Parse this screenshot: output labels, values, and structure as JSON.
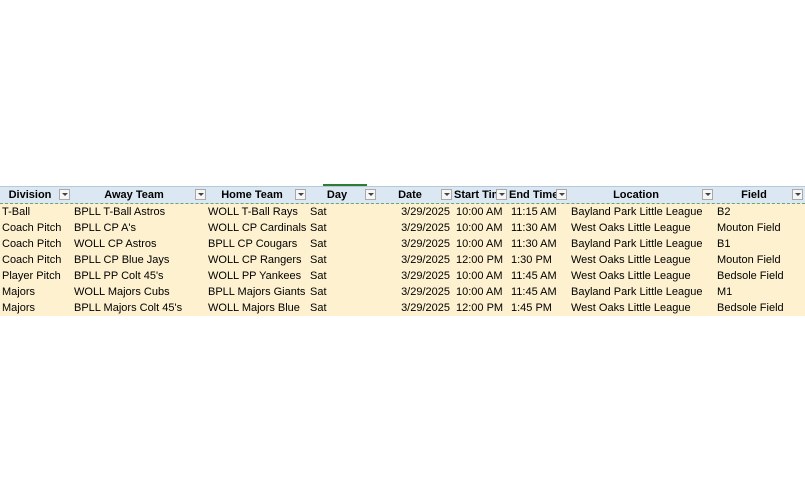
{
  "table": {
    "headers": [
      "Division",
      "Away Team",
      "Home Team",
      "Day",
      "Date",
      "Start Tim",
      "End Time",
      "Location",
      "Field"
    ],
    "rows": [
      [
        "T-Ball",
        "BPLL T-Ball Astros",
        "WOLL T-Ball Rays",
        "Sat",
        "3/29/2025",
        "10:00 AM",
        "11:15 AM",
        "Bayland Park Little League",
        "B2"
      ],
      [
        "Coach Pitch",
        "BPLL CP A's",
        "WOLL CP Cardinals",
        "Sat",
        "3/29/2025",
        "10:00 AM",
        "11:30 AM",
        "West Oaks Little League",
        "Mouton Field"
      ],
      [
        "Coach Pitch",
        "WOLL CP Astros",
        "BPLL CP Cougars",
        "Sat",
        "3/29/2025",
        "10:00 AM",
        "11:30 AM",
        "Bayland Park Little League",
        "B1"
      ],
      [
        "Coach Pitch",
        "BPLL CP Blue Jays",
        "WOLL CP Rangers",
        "Sat",
        "3/29/2025",
        "12:00 PM",
        "1:30 PM",
        "West Oaks Little League",
        "Mouton Field"
      ],
      [
        "Player Pitch",
        "BPLL PP Colt 45's",
        "WOLL PP Yankees",
        "Sat",
        "3/29/2025",
        "10:00 AM",
        "11:45 AM",
        "West Oaks Little League",
        "Bedsole Field"
      ],
      [
        "Majors",
        "WOLL Majors Cubs",
        "BPLL Majors Giants",
        "Sat",
        "3/29/2025",
        "10:00 AM",
        "11:45 AM",
        "Bayland Park Little League",
        "M1"
      ],
      [
        "Majors",
        "BPLL Majors Colt 45's",
        "WOLL Majors Blue",
        "Sat",
        "3/29/2025",
        "12:00 PM",
        "1:45 PM",
        "West Oaks Little League",
        "Bedsole Field"
      ]
    ]
  },
  "colors": {
    "header_bg": "#dbe8f3",
    "row_bg": "#fdf1cf",
    "selection_accent": "#2e7d32"
  },
  "icons": {
    "filter": "filter-dropdown-icon"
  }
}
